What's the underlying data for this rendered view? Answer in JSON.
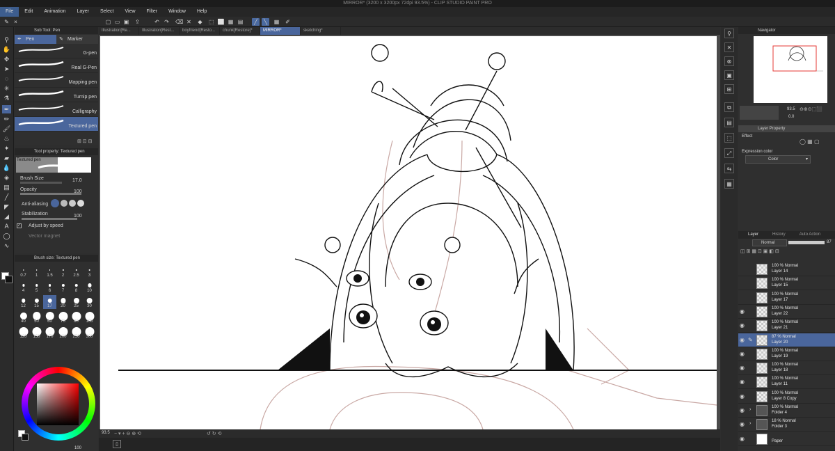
{
  "window": {
    "title": "MIRROR* (3200 x 3200px 72dpi 93.5%) - CLIP STUDIO PAINT PRO"
  },
  "menu": [
    "File",
    "Edit",
    "Animation",
    "Layer",
    "Select",
    "View",
    "Filter",
    "Window",
    "Help"
  ],
  "doc_tabs": [
    "Illustration[Re...",
    "Illustration[Rest...",
    "boyfriend[Resto...",
    "chunk[Restore]*",
    "MIRROR*",
    "sketching*"
  ],
  "subtool": {
    "title": "Sub Tool: Pen",
    "tabs": [
      "Pen",
      "Marker"
    ],
    "brushes": [
      "G-pen",
      "Real G-Pen",
      "Mapping pen",
      "Turnip pen",
      "Calligraphy",
      "Textured pen"
    ],
    "selected": "Textured pen"
  },
  "tool_property": {
    "title": "Tool property: Textured pen",
    "preview_label": "Textured pen",
    "brush_size_label": "Brush Size",
    "brush_size_value": "17.0",
    "opacity_label": "Opacity",
    "opacity_value": "100",
    "antialias_label": "Anti-aliasing",
    "stabilization_label": "Stabilization",
    "stabilization_value": "100",
    "adjust_speed_label": "Adjust by speed",
    "vector_magnet_label": "Vector magnet"
  },
  "brush_size": {
    "title": "Brush size: Textured pen",
    "sizes": [
      "0.7",
      "1",
      "1.5",
      "2",
      "2.5",
      "3",
      "4",
      "5",
      "6",
      "7",
      "8",
      "10",
      "12",
      "15",
      "17",
      "20",
      "25",
      "30",
      "40",
      "50",
      "60",
      "70",
      "80",
      "100",
      "120",
      "150",
      "170",
      "200",
      "250",
      "300"
    ],
    "selected": "17"
  },
  "status": {
    "zoom": "93.5",
    "color_value": "100"
  },
  "navigator": {
    "title": "Navigator",
    "zoom": "93.5",
    "angle": "0.0"
  },
  "layer_property": {
    "title": "Layer Property",
    "effect_label": "Effect",
    "expression_label": "Expression color",
    "expression_value": "Color"
  },
  "layer_panel": {
    "tabs": [
      "Layer",
      "History",
      "Auto Action"
    ],
    "blend_mode": "Normal",
    "opacity": "87",
    "layers": [
      {
        "l1": "100 % Normal",
        "l2": "Layer 14",
        "visible": false
      },
      {
        "l1": "100 % Normal",
        "l2": "Layer 15",
        "visible": false
      },
      {
        "l1": "100 % Normal",
        "l2": "Layer 17",
        "visible": false
      },
      {
        "l1": "100 % Normal",
        "l2": "Layer 22",
        "visible": true
      },
      {
        "l1": "100 % Normal",
        "l2": "Layer 21",
        "visible": true
      },
      {
        "l1": "87 % Normal",
        "l2": "Layer 20",
        "visible": true,
        "selected": true
      },
      {
        "l1": "100 % Normal",
        "l2": "Layer 19",
        "visible": true
      },
      {
        "l1": "100 % Normal",
        "l2": "Layer 18",
        "visible": true
      },
      {
        "l1": "100 % Normal",
        "l2": "Layer 11",
        "visible": true
      },
      {
        "l1": "100 % Normal",
        "l2": "Layer 8 Copy",
        "visible": true
      },
      {
        "l1": "100 % Normal",
        "l2": "Folder 4",
        "visible": true,
        "folder": true
      },
      {
        "l1": "18 % Normal",
        "l2": "Folder 3",
        "visible": true,
        "folder": true
      },
      {
        "l1": "",
        "l2": "Paper",
        "visible": true,
        "paper": true
      }
    ]
  },
  "colors": {
    "accent": "#4a669c",
    "bg": "#2e2e2e",
    "paper": "#ffffff"
  }
}
